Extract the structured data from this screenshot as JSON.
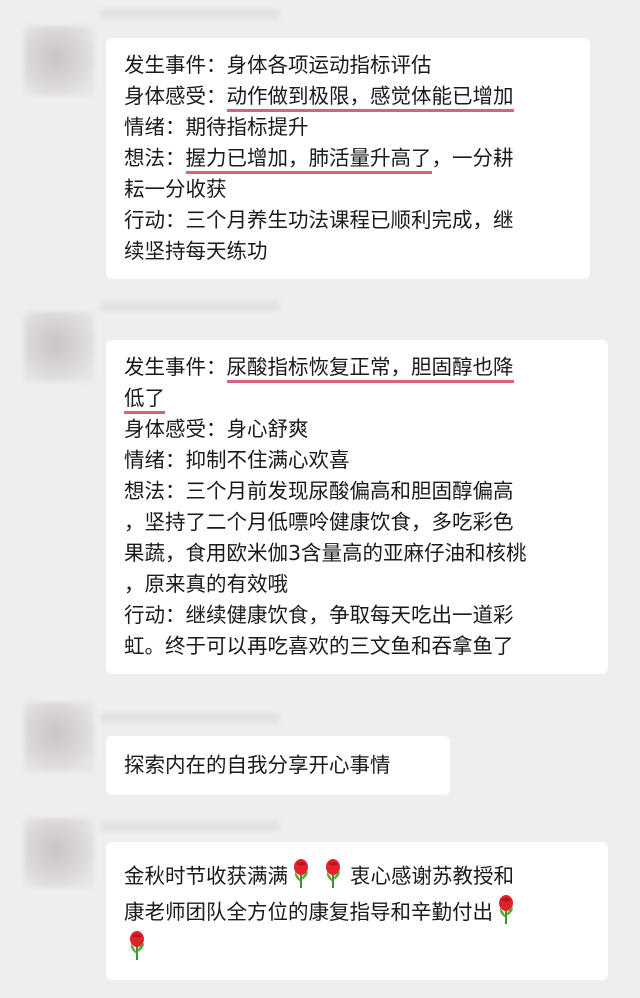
{
  "messages": [
    {
      "lines": [
        {
          "pre": "发生事件：身体各项运动指标评估",
          "u": "",
          "post": ""
        },
        {
          "pre": "身体感受：",
          "u": "动作做到极限，感觉体能已增加",
          "post": ""
        },
        {
          "pre": "情绪：期待指标提升",
          "u": "",
          "post": ""
        },
        {
          "pre": "想法：",
          "u": "握力已增加，肺活量升高了",
          "post": "，一分耕"
        },
        {
          "pre": "耘一分收获",
          "u": "",
          "post": ""
        },
        {
          "pre": "行动：三个月养生功法课程已顺利完成，继",
          "u": "",
          "post": ""
        },
        {
          "pre": "续坚持每天练功",
          "u": "",
          "post": ""
        }
      ]
    },
    {
      "lines": [
        {
          "pre": "发生事件：",
          "u": "尿酸指标恢复正常，胆固醇也降",
          "post": ""
        },
        {
          "pre": "",
          "u": "低了",
          "post": ""
        },
        {
          "pre": "身体感受：身心舒爽",
          "u": "",
          "post": ""
        },
        {
          "pre": "情绪：抑制不住满心欢喜",
          "u": "",
          "post": ""
        },
        {
          "pre": "想法：三个月前发现尿酸偏高和胆固醇偏高",
          "u": "",
          "post": ""
        },
        {
          "pre": "，坚持了二个月低嘌呤健康饮食，多吃彩色",
          "u": "",
          "post": ""
        },
        {
          "pre": "果蔬，食用欧米伽3含量高的亚麻仔油和核桃",
          "u": "",
          "post": ""
        },
        {
          "pre": "，原来真的有效哦",
          "u": "",
          "post": ""
        },
        {
          "pre": "行动：继续健康饮食，争取每天吃出一道彩",
          "u": "",
          "post": ""
        },
        {
          "pre": "虹。终于可以再吃喜欢的三文鱼和吞拿鱼了",
          "u": "",
          "post": ""
        }
      ]
    },
    {
      "lines": [
        {
          "pre": "探索内在的自我分享开心事情",
          "u": "",
          "post": ""
        }
      ]
    },
    {
      "line1_a": "金秋时节收获满满",
      "line1_b": "衷心感谢苏教授和",
      "line2": "康老师团队全方位的康复指导和辛勤付出"
    }
  ],
  "icons": {
    "emoji": "rose-icon"
  },
  "colors": {
    "underline": "#d9617b",
    "bubble": "#ffffff",
    "background": "#eeeeee"
  }
}
